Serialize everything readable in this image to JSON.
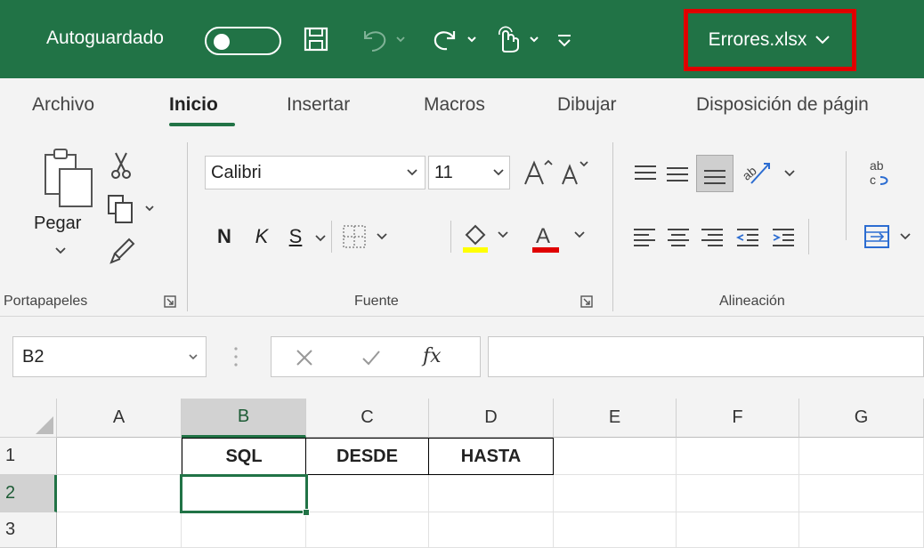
{
  "titlebar": {
    "autosave_label": "Autoguardado",
    "filename": "Errores.xlsx",
    "accent": "#217346",
    "highlight": "#e00000",
    "icons": [
      "save-icon",
      "undo-icon",
      "redo-icon",
      "touch-mode-icon",
      "customize-qat-icon",
      "chevron-down-icon"
    ]
  },
  "tabs": [
    "Archivo",
    "Inicio",
    "Insertar",
    "Macros",
    "Dibujar",
    "Disposición de págin"
  ],
  "active_tab": "Inicio",
  "ribbon": {
    "clipboard": {
      "paste_label": "Pegar",
      "group_label": "Portapapeles"
    },
    "font": {
      "font_name": "Calibri",
      "font_size": "11",
      "bold": "N",
      "italic": "K",
      "underline": "S",
      "font_color_letter": "A",
      "group_label": "Fuente",
      "highlight_color": "#ffff00",
      "font_color": "#e00000"
    },
    "alignment": {
      "group_label": "Alineación"
    }
  },
  "formula_bar": {
    "name_box": "B2",
    "fx": "fx",
    "formula": ""
  },
  "sheet": {
    "columns": [
      "A",
      "B",
      "C",
      "D",
      "E",
      "F",
      "G"
    ],
    "rows": [
      "1",
      "2",
      "3"
    ],
    "selected_column": "B",
    "selected_row": "2",
    "headers": {
      "B1": "SQL",
      "C1": "DESDE",
      "D1": "HASTA"
    }
  }
}
